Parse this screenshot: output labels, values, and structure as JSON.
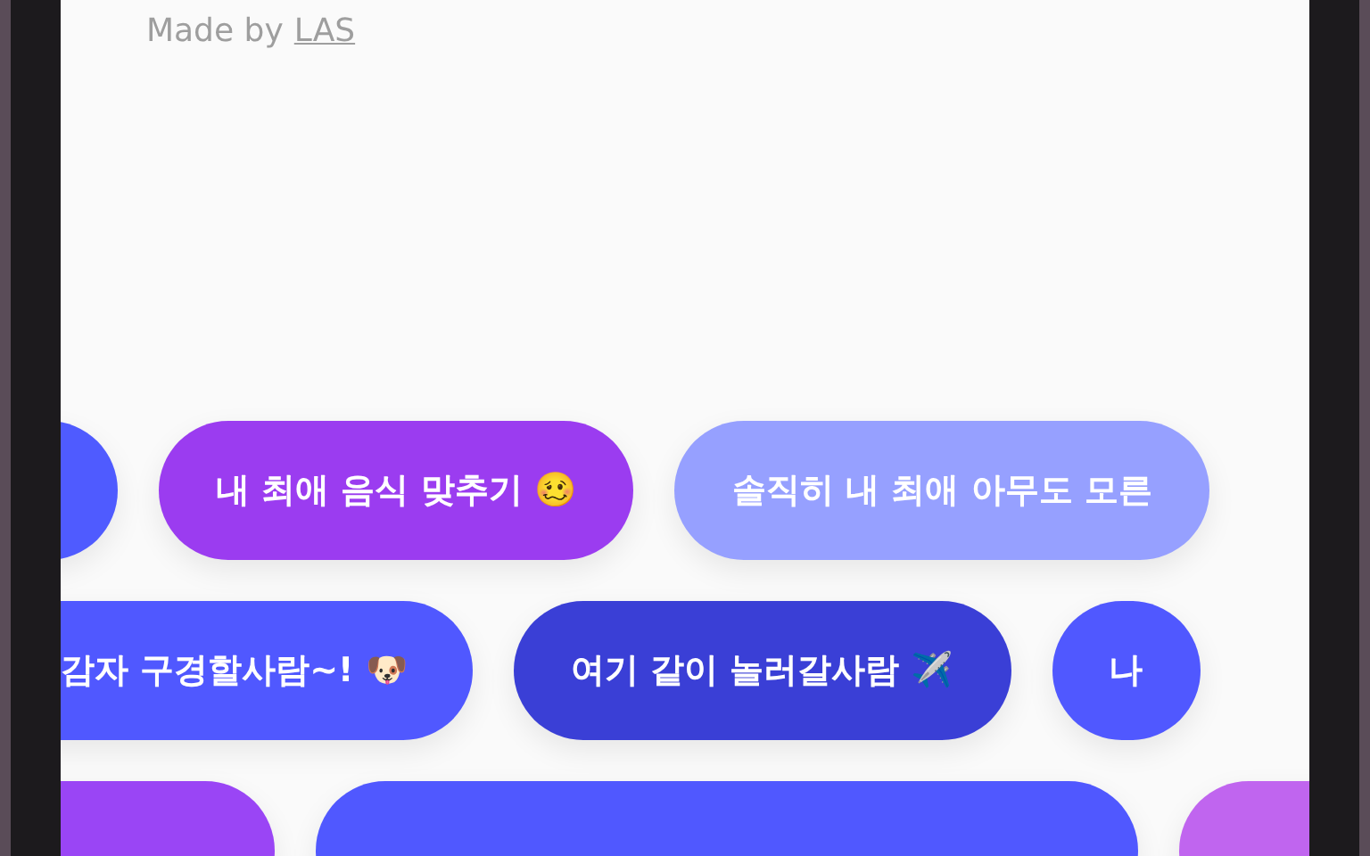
{
  "credit": {
    "prefix": "Made by",
    "link": "LAS"
  },
  "chip_rows": [
    {
      "chips": [
        {
          "color": "#4f5bff"
        },
        {
          "text": "내 최애 음식 맞추기 🥴",
          "color": "#9b3cf0"
        },
        {
          "text": "솔직히 내 최애 아무도 모른",
          "color": "#96a0ff"
        }
      ]
    },
    {
      "chips": [
        {
          "text": "감자 구경할사람~! 🐶",
          "color": "#5058ff"
        },
        {
          "text": "여기 같이 놀러갈사람 ✈️",
          "color": "#3a3fd6"
        },
        {
          "text": "나",
          "color": "#5058ff"
        }
      ]
    },
    {
      "chips": [
        {
          "color": "#9a45f5"
        },
        {
          "color": "#5058ff"
        },
        {
          "color": "#c065ef"
        }
      ]
    }
  ]
}
